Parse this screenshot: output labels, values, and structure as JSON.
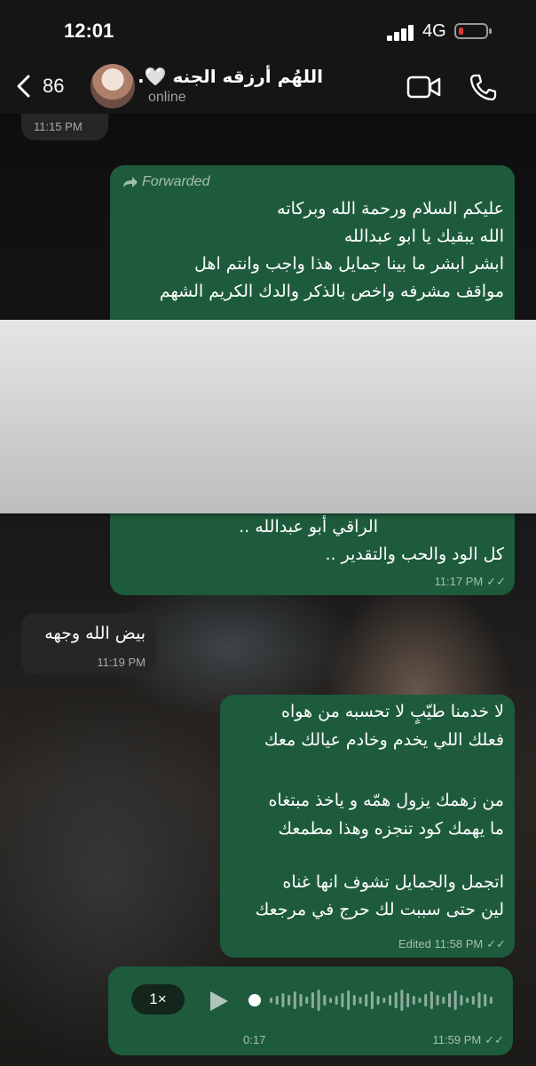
{
  "status_bar": {
    "time": "12:01",
    "network": "4G"
  },
  "header": {
    "back_count": "86",
    "contact_name": "اللهُم أرزقه الجنه 🤍.",
    "status": "online"
  },
  "messages": {
    "first_time": "11:15 PM",
    "forwarded": {
      "label": "Forwarded",
      "top_lines": [
        "عليكم السلام ورحمة الله وبركاته",
        "الله يبقيك يا ابو عبدالله",
        "ابشر ابشر ما بينا جمايل هذا واجب وانتم اهل",
        "مواقف مشرفه واخص بالذكر والدك الكريم الشهم"
      ],
      "bottom_lines": [
        "الراقي أبو عبدالله ..",
        "كل الود والحب والتقدير .."
      ],
      "time": "11:17 PM"
    },
    "reply": {
      "text": "بيض الله وجهه",
      "time": "11:19 PM"
    },
    "poem": {
      "lines": [
        "لا خدمنا طيّبٍ لا تحسبه من هواه",
        "فعلك اللي يخدم وخادم عيالك معك",
        "",
        "من زهمك يزول همّه و ياخذ مبتغاه",
        "ما يهمك كود تنجزه وهذا مطمعك",
        "",
        "اتجمل والجمايل تشوف انها غناه",
        "لين حتى سببت لك حرج في مرجعك"
      ],
      "edited": "Edited",
      "time": "11:58 PM"
    },
    "voice": {
      "speed": "1×",
      "duration": "0:17",
      "time": "11:59 PM"
    }
  },
  "colors": {
    "outgoing": "#1d5b3c",
    "incoming": "#262626",
    "battery_low": "#e53935"
  }
}
